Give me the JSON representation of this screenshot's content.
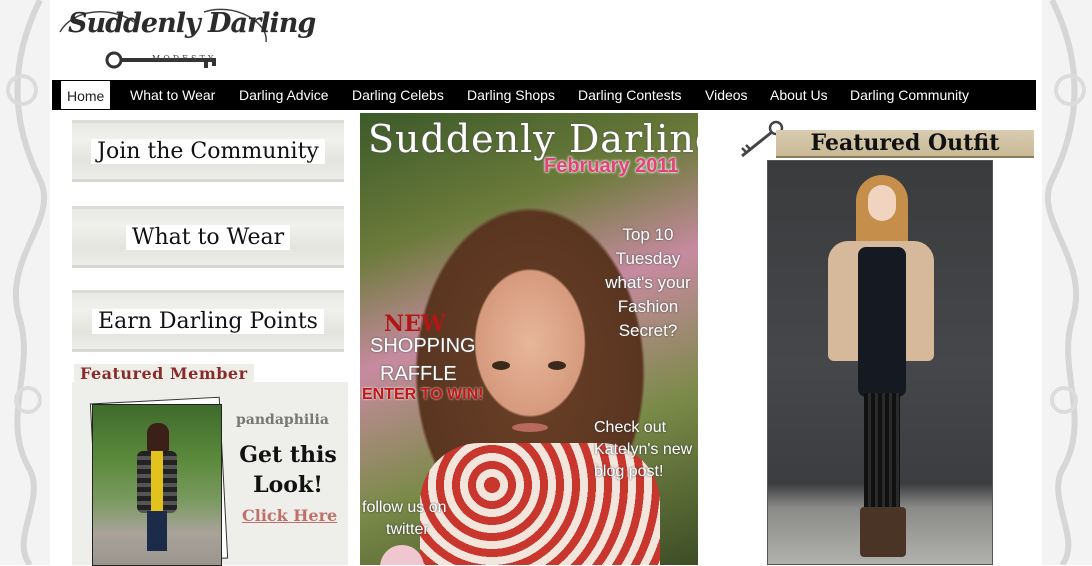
{
  "site": {
    "logo_text": "Suddenly Darling",
    "logo_sub": "MODESTY"
  },
  "nav": {
    "items": [
      {
        "label": "Home",
        "active": true
      },
      {
        "label": "What to Wear"
      },
      {
        "label": "Darling Advice"
      },
      {
        "label": "Darling Celebs"
      },
      {
        "label": "Darling Shops"
      },
      {
        "label": "Darling Contests"
      },
      {
        "label": "Videos"
      },
      {
        "label": "About Us"
      },
      {
        "label": "Darling Community"
      }
    ]
  },
  "left": {
    "buttons": [
      "Join the Community",
      "What to Wear",
      "Earn Darling Points"
    ],
    "featured_member": {
      "title": "Featured Member",
      "name": "pandaphilia",
      "get_look": "Get this Look!",
      "click_here": "Click Here"
    }
  },
  "magazine": {
    "title": "Suddenly Darling",
    "date": "February 2011",
    "top10": "Top 10 Tuesday what's your Fashion Secret?",
    "new": "NEW",
    "shopping": "SHOPPING",
    "raffle": "RAFFLE",
    "enter": "ENTER TO WIN!",
    "check": "Check out Katelyn's new blog post!",
    "follow": "follow us on",
    "twitter": "twitter"
  },
  "featured_outfit": {
    "title": "Featured Outfit"
  },
  "colors": {
    "nav_bg": "#000000",
    "featured_member_title": "#8a2b2b",
    "click_here": "#c0706a",
    "mag_date": "#e0427a",
    "mag_new": "#b01818"
  }
}
